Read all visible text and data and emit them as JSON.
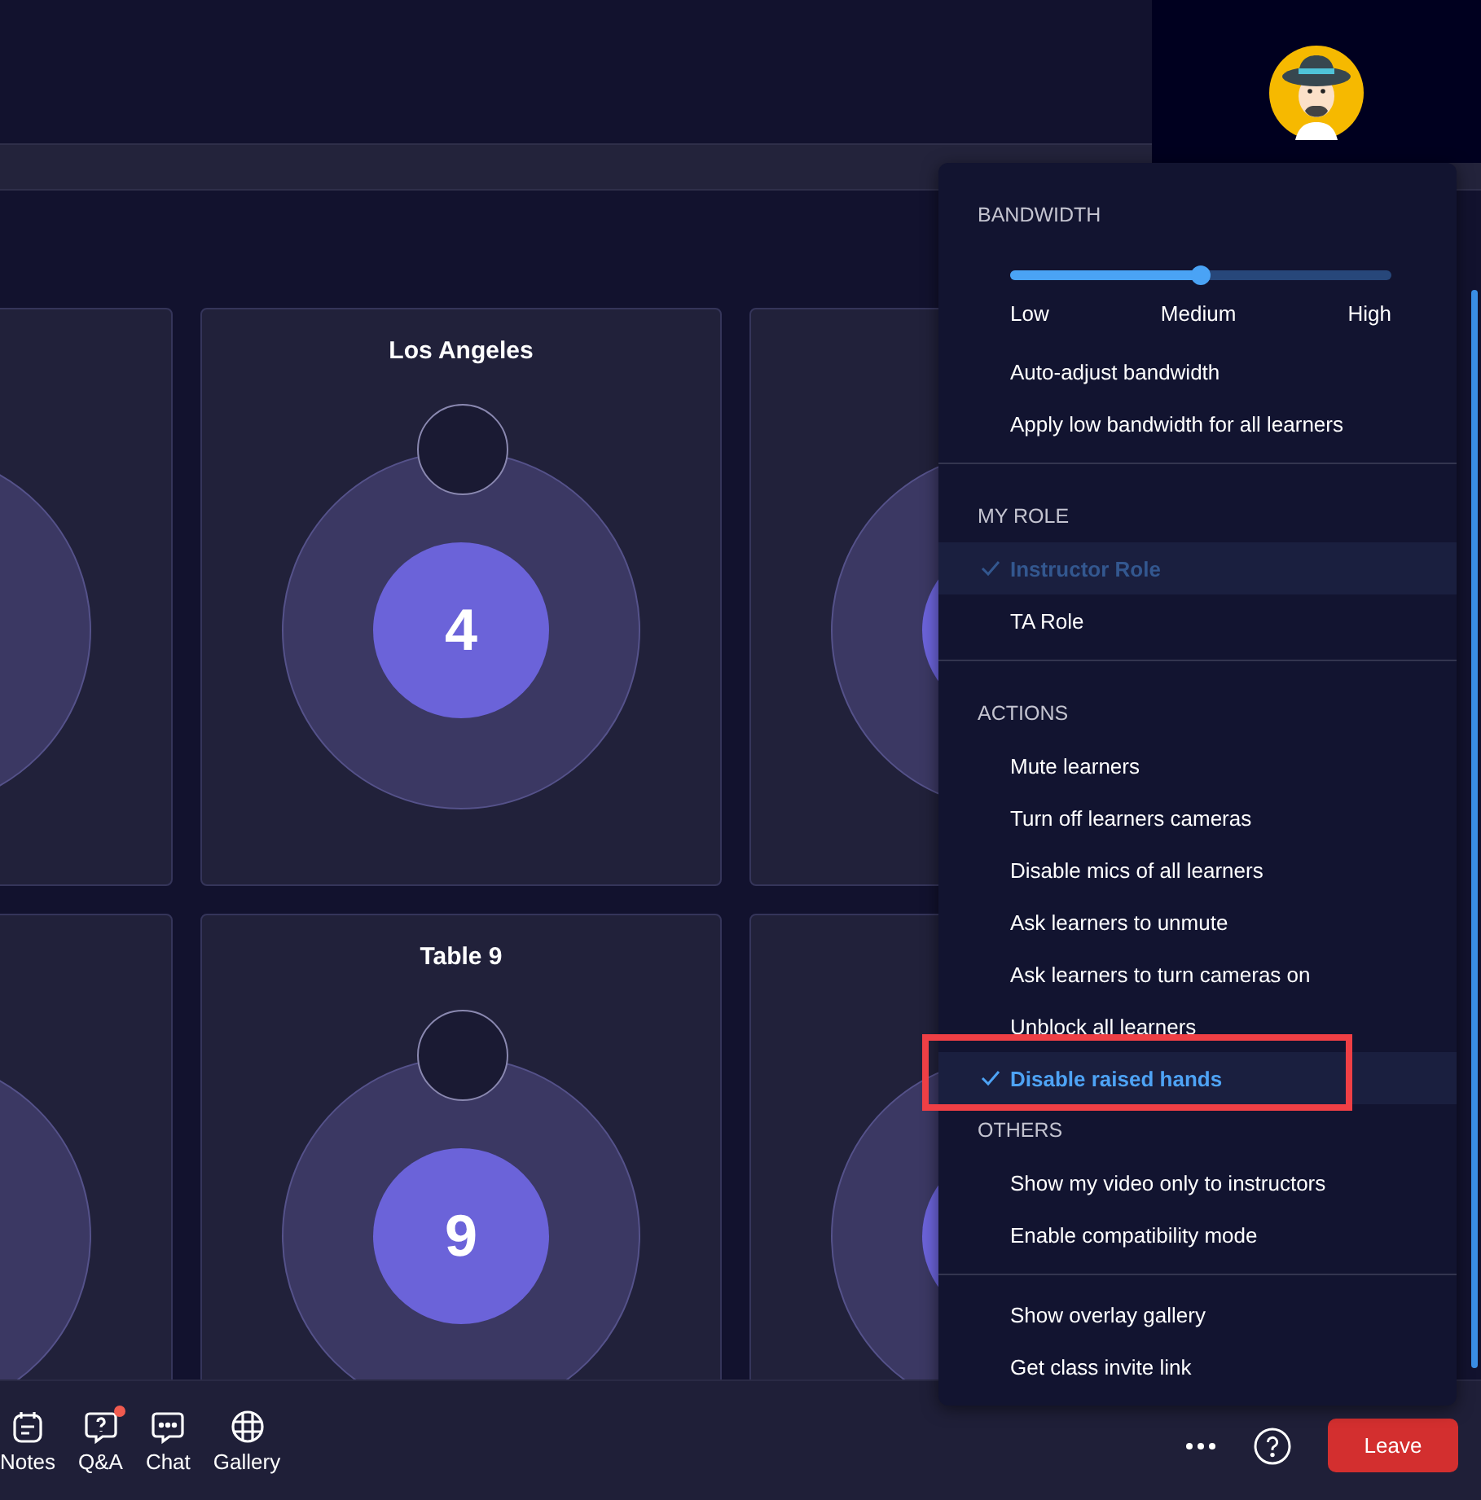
{
  "cards": [
    {
      "kind": "partial"
    },
    {
      "kind": "room",
      "title": "Los Angeles",
      "number": "4"
    },
    {
      "kind": "partial"
    },
    {
      "kind": "partial"
    },
    {
      "kind": "room",
      "title": "Table 9",
      "number": "9"
    },
    {
      "kind": "partial"
    }
  ],
  "toolbar": [
    {
      "kind": "notes",
      "label": "Notes",
      "badge": false
    },
    {
      "kind": "qa",
      "label": "Q&A",
      "badge": true
    },
    {
      "kind": "chat",
      "label": "Chat",
      "badge": false
    },
    {
      "kind": "gallery",
      "label": "Gallery",
      "badge": false
    }
  ],
  "leave_button": "Leave",
  "menu": {
    "groups": [
      {
        "sections": [
          {
            "header": "BANDWIDTH",
            "slider": {
              "level": 0.5,
              "labels": [
                "Low",
                "Medium",
                "High"
              ]
            },
            "items": [
              {
                "label": "Auto-adjust bandwidth",
                "checked": false,
                "disabled": false,
                "highlighted": false
              },
              {
                "label": "Apply low bandwidth for all learners",
                "checked": false,
                "disabled": false,
                "highlighted": false
              }
            ]
          }
        ]
      },
      {
        "sections": [
          {
            "header": "MY ROLE",
            "items": [
              {
                "label": "Instructor Role",
                "checked": true,
                "disabled": true,
                "highlighted": false
              },
              {
                "label": "TA Role",
                "checked": false,
                "disabled": false,
                "highlighted": false
              }
            ]
          }
        ]
      },
      {
        "sections": [
          {
            "header": "ACTIONS",
            "items": [
              {
                "label": "Mute learners",
                "checked": false,
                "disabled": false,
                "highlighted": false
              },
              {
                "label": "Turn off learners cameras",
                "checked": false,
                "disabled": false,
                "highlighted": false
              },
              {
                "label": "Disable mics of all learners",
                "checked": false,
                "disabled": false,
                "highlighted": false
              },
              {
                "label": "Ask learners to unmute",
                "checked": false,
                "disabled": false,
                "highlighted": false
              },
              {
                "label": "Ask learners to turn cameras on",
                "checked": false,
                "disabled": false,
                "highlighted": false
              },
              {
                "label": "Unblock all learners",
                "checked": false,
                "disabled": false,
                "highlighted": false
              },
              {
                "label": "Disable raised hands",
                "checked": true,
                "disabled": false,
                "highlighted": true
              }
            ]
          },
          {
            "header": "OTHERS",
            "items": [
              {
                "label": "Show my video only to instructors",
                "checked": false,
                "disabled": false,
                "highlighted": false
              },
              {
                "label": "Enable compatibility mode",
                "checked": false,
                "disabled": false,
                "highlighted": false
              }
            ]
          }
        ]
      },
      {
        "sections": [
          {
            "items": [
              {
                "label": "Show overlay gallery",
                "checked": false,
                "disabled": false,
                "highlighted": false
              },
              {
                "label": "Get class invite link",
                "checked": false,
                "disabled": false,
                "highlighted": false
              }
            ]
          }
        ]
      }
    ]
  }
}
